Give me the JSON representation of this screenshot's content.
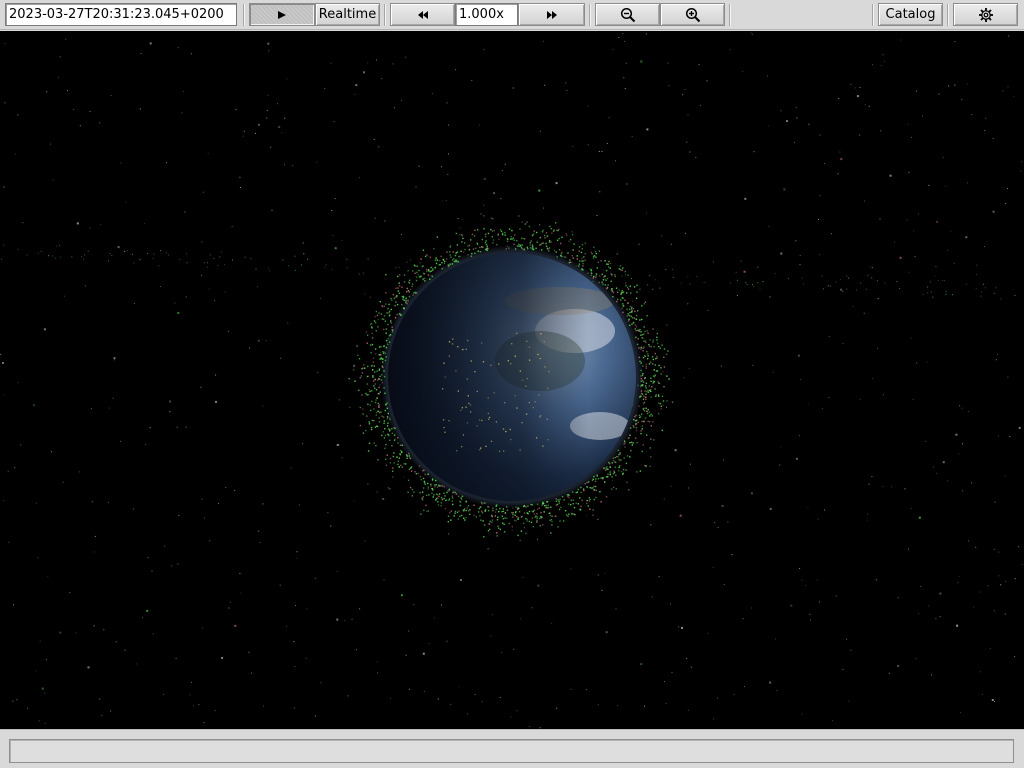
{
  "toolbar": {
    "datetime": "2023-03-27T20:31:23.045+0200",
    "play_icon": "play-icon",
    "realtime_label": "Realtime",
    "rewind_icon": "rewind-icon",
    "speed": "1.000x",
    "fast_forward_icon": "fast-forward-icon",
    "zoom_out_icon": "zoom-out-icon",
    "zoom_in_icon": "zoom-in-icon",
    "catalog_label": "Catalog",
    "settings_icon": "gear-icon"
  },
  "viewport": {
    "scene": "earth-with-orbiting-satellites",
    "colors": {
      "space": "#000000",
      "satellite_primary": "#5fdc5a",
      "satellite_secondary": "#c06a7a",
      "star": "#cfcfcf",
      "ocean": "#2f4f78",
      "night_side": "#0b1320"
    }
  },
  "statusbar": {
    "message": ""
  }
}
